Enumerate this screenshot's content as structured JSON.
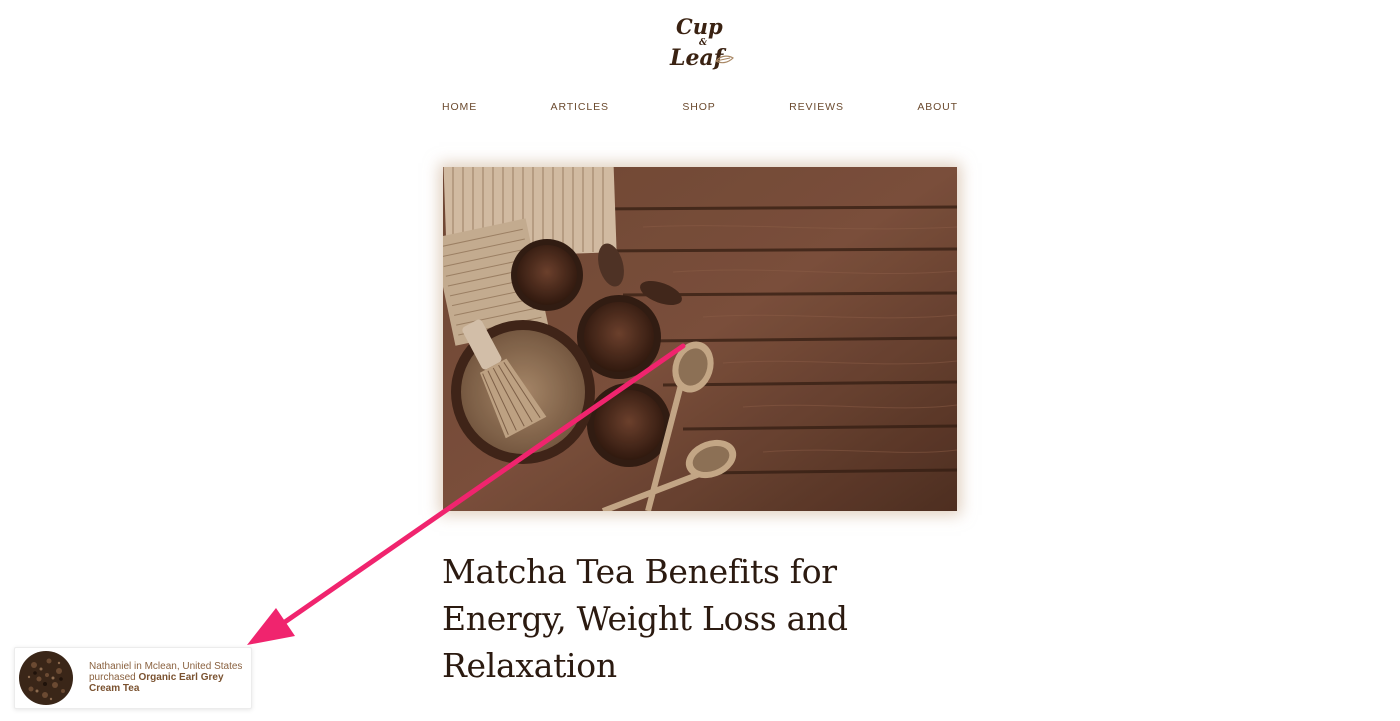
{
  "logo": {
    "line1": "Cup",
    "amp": "&",
    "line2": "Leaf"
  },
  "nav": {
    "items": [
      {
        "label": "HOME"
      },
      {
        "label": "ARTICLES"
      },
      {
        "label": "SHOP"
      },
      {
        "label": "REVIEWS"
      },
      {
        "label": "ABOUT"
      }
    ]
  },
  "article": {
    "title": "Matcha Tea Benefits for Energy, Weight Loss and Relaxation"
  },
  "notification": {
    "prefix": "Nathaniel in Mclean, United States purchased ",
    "product": "Organic Earl Grey Cream Tea"
  },
  "colors": {
    "brand_brown": "#6b4a2e",
    "title_dark": "#2b1a10",
    "annotation_arrow": "#f0246e"
  }
}
